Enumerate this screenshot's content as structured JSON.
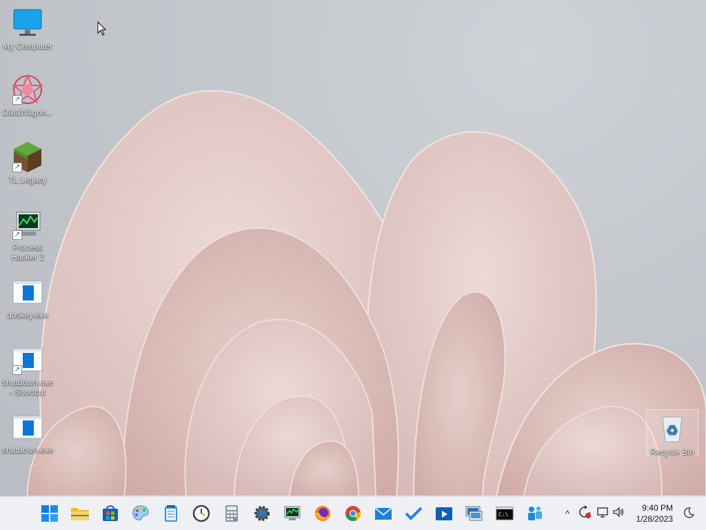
{
  "desktop": {
    "icons": [
      {
        "label": "My Computer"
      },
      {
        "label": "DataWagon..."
      },
      {
        "label": "TL Legacy"
      },
      {
        "label": "Process Hacker 2"
      },
      {
        "label": "doskey.exe"
      },
      {
        "label": "shutdown.exe - Shortcut"
      },
      {
        "label": "shutdown.exe"
      }
    ],
    "recycle_bin": {
      "label": "Recycle Bin"
    },
    "shortcut_arrow": "↗"
  },
  "taskbar": {
    "apps": [
      {
        "name": "start-icon"
      },
      {
        "name": "file-explorer-icon"
      },
      {
        "name": "store-icon"
      },
      {
        "name": "paint-icon"
      },
      {
        "name": "notepad-icon"
      },
      {
        "name": "clock-icon"
      },
      {
        "name": "calculator-icon"
      },
      {
        "name": "settings-icon"
      },
      {
        "name": "task-manager-icon"
      },
      {
        "name": "firefox-icon"
      },
      {
        "name": "chrome-icon"
      },
      {
        "name": "mail-icon"
      },
      {
        "name": "todo-icon"
      },
      {
        "name": "media-player-icon"
      },
      {
        "name": "remote-desktop-icon"
      },
      {
        "name": "terminal-icon"
      },
      {
        "name": "teams-icon"
      }
    ],
    "tray": {
      "chevron": "^",
      "time": "9:40 PM",
      "date": "1/28/2023"
    }
  },
  "colors": {
    "accent": "#0078d4",
    "taskbar_bg": "#eef0f4",
    "wallpaper_petal": "#e3c9c6"
  }
}
